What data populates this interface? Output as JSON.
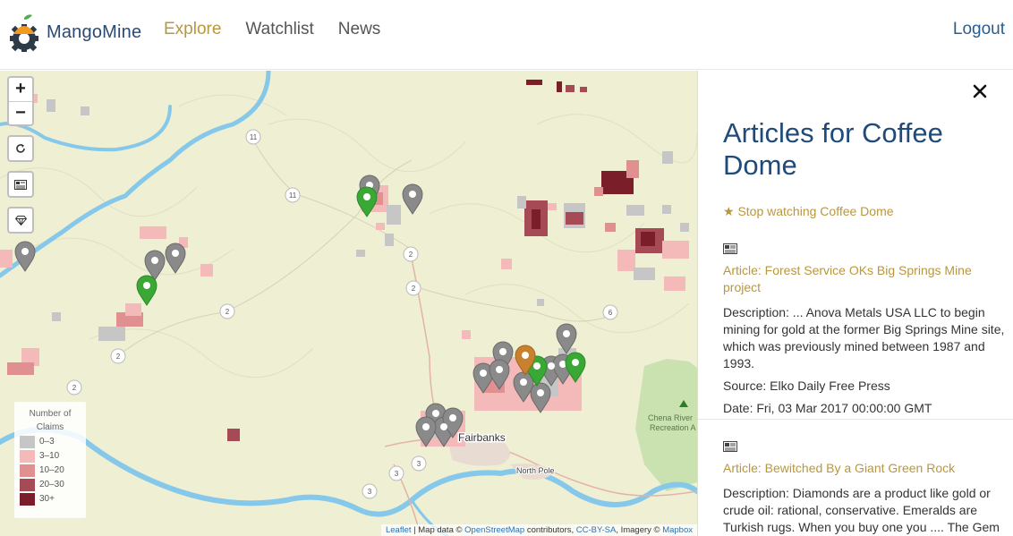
{
  "app": {
    "name": "MangoMine"
  },
  "nav": {
    "items": [
      "Explore",
      "Watchlist",
      "News"
    ],
    "active": "Explore",
    "logout": "Logout"
  },
  "map": {
    "controls": {
      "zoom_in": "+",
      "zoom_out": "−"
    },
    "legend": {
      "title": "Number of Claims",
      "items": [
        {
          "label": "0–3",
          "color": "#c6c6c6"
        },
        {
          "label": "3–10",
          "color": "#f4b9b9"
        },
        {
          "label": "10–20",
          "color": "#e09090"
        },
        {
          "label": "20–30",
          "color": "#a64a56"
        },
        {
          "label": "30+",
          "color": "#7a1e2a"
        }
      ]
    },
    "labels": {
      "city1": "Fairbanks",
      "city2": "North Pole",
      "park1": "Chena River",
      "park2": "Recreation A"
    },
    "road_shields": [
      "11",
      "11",
      "2",
      "2",
      "2",
      "2",
      "6",
      "2",
      "3",
      "3",
      "3"
    ],
    "attribution": {
      "leaflet": "Leaflet",
      "text1": " | Map data © ",
      "osm": "OpenStreetMap",
      "text2": " contributors, ",
      "license": "CC-BY-SA",
      "text3": ", Imagery © ",
      "mapbox": "Mapbox"
    },
    "colors": {
      "grey_pin": "#8a8a8a",
      "green_pin": "#3aa835",
      "orange_pin": "#c8822e",
      "river": "#86c8ea",
      "land": "#efefd4",
      "park": "#c9e2b0"
    }
  },
  "panel": {
    "title": "Articles for Coffee Dome",
    "stop_watch_prefix": "Stop watching ",
    "stop_watch_name": "Coffee Dome",
    "articles": [
      {
        "title": "Article: Forest Service OKs Big Springs Mine project",
        "description_lines": [
          "Description: ... Anova Metals USA LLC to begin",
          "mining for gold at the former Big Springs Mine site,",
          "which was previously mined between 1987 and",
          "1993."
        ],
        "source": "Source: Elko Daily Free Press",
        "date": "Date: Fri, 03 Mar 2017 00:00:00 GMT"
      },
      {
        "title": "Article: Bewitched By a Giant Green Rock",
        "description_lines": [
          "Description: Diamonds are a product like gold or",
          "crude oil: rational, conservative. Emeralds are",
          "Turkish rugs. When you buy one you .... The Gem of"
        ]
      }
    ]
  }
}
